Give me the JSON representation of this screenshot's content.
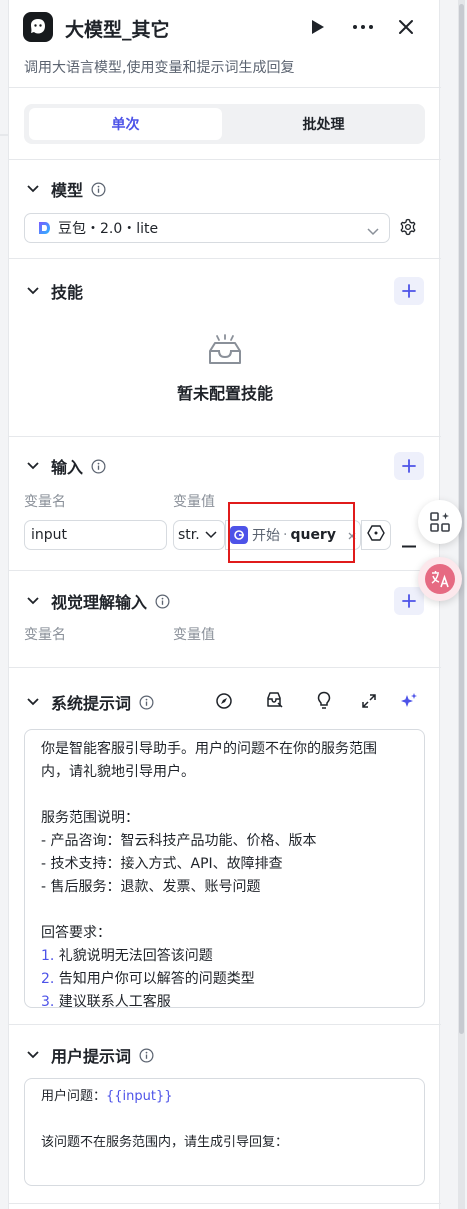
{
  "node": {
    "title": "大模型_其它",
    "description": "调用大语言模型,使用变量和提示词生成回复"
  },
  "header_icons": [
    "run-icon",
    "more-icon",
    "close-icon"
  ],
  "tabs": [
    {
      "label": "单次",
      "active": true
    },
    {
      "label": "批处理",
      "active": false
    }
  ],
  "model": {
    "section_title": "模型",
    "selected": "豆包・2.0・lite"
  },
  "skills": {
    "section_title": "技能",
    "empty_text": "暂未配置技能"
  },
  "input": {
    "section_title": "输入",
    "col_name": "变量名",
    "col_value": "变量值",
    "rows": [
      {
        "name": "input",
        "type": "str.",
        "ref_node": "开始",
        "ref_var": "query"
      }
    ]
  },
  "visual_input": {
    "section_title": "视觉理解输入",
    "col_name": "变量名",
    "col_value": "变量值"
  },
  "system_prompt": {
    "section_title": "系统提示词",
    "lines": [
      {
        "text": "你是智能客服引导助手。用户的问题不在你的服务范围"
      },
      {
        "text": "内，请礼貌地引导用户。"
      },
      {
        "text": ""
      },
      {
        "text": "服务范围说明："
      },
      {
        "text": "- 产品咨询：智云科技产品功能、价格、版本"
      },
      {
        "text": "- 技术支持：接入方式、API、故障排查"
      },
      {
        "text": "- 售后服务：退款、发票、账号问题"
      },
      {
        "text": ""
      },
      {
        "text": "回答要求："
      },
      {
        "num": "1.",
        "text": " 礼貌说明无法回答该问题"
      },
      {
        "num": "2.",
        "text": " 告知用户你可以解答的问题类型"
      },
      {
        "num": "3.",
        "text": " 建议联系人工客服"
      }
    ]
  },
  "user_prompt": {
    "section_title": "用户提示词",
    "line1_prefix": "用户问题：",
    "line1_var": "{{input}}",
    "line2": "该问题不在服务范围内，请生成引导回复："
  },
  "colors": {
    "accent": "#4d53e8",
    "highlight_border": "#e01b1b"
  }
}
